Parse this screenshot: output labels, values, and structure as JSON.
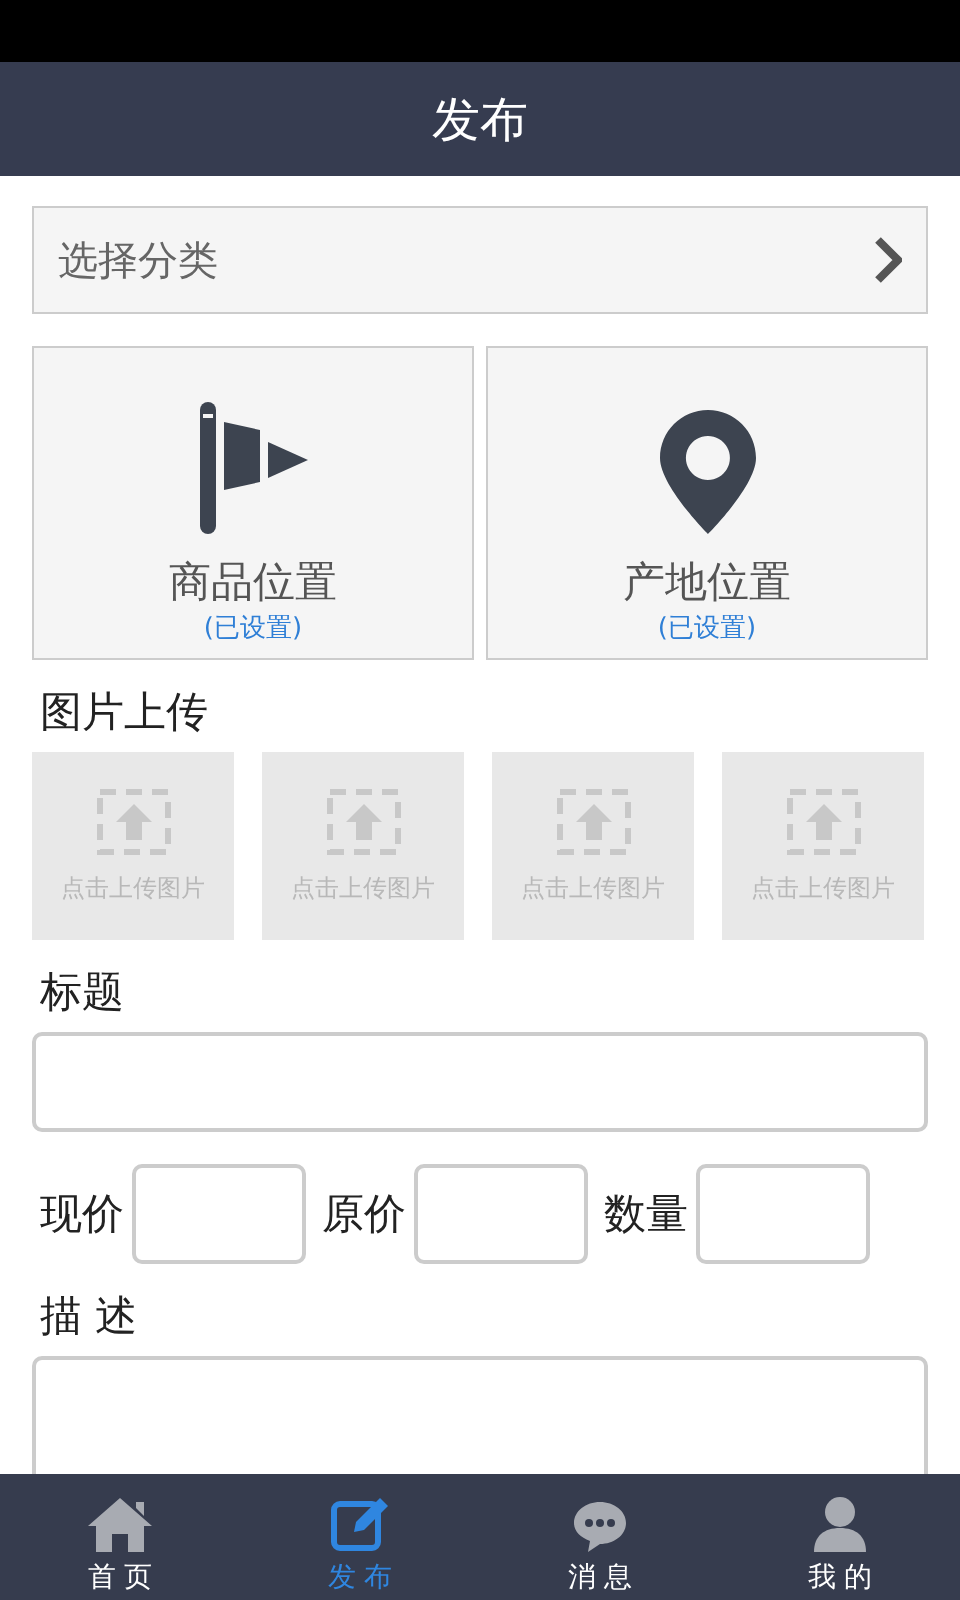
{
  "header": {
    "title": "发布"
  },
  "category": {
    "placeholder": "选择分类"
  },
  "locations": [
    {
      "label": "商品位置",
      "status": "(已设置)"
    },
    {
      "label": "产地位置",
      "status": "(已设置)"
    }
  ],
  "upload": {
    "label": "图片上传",
    "tiles": [
      "点击上传图片",
      "点击上传图片",
      "点击上传图片",
      "点击上传图片"
    ]
  },
  "title_field": {
    "label": "标题"
  },
  "prices": [
    {
      "label": "现价"
    },
    {
      "label": "原价"
    },
    {
      "label": "数量"
    }
  ],
  "description": {
    "label": "描 述"
  },
  "tab_bar": [
    {
      "label": "首 页",
      "selected": false
    },
    {
      "label": "发 布",
      "selected": true
    },
    {
      "label": "消 息",
      "selected": false
    },
    {
      "label": "我 的",
      "selected": false
    }
  ]
}
